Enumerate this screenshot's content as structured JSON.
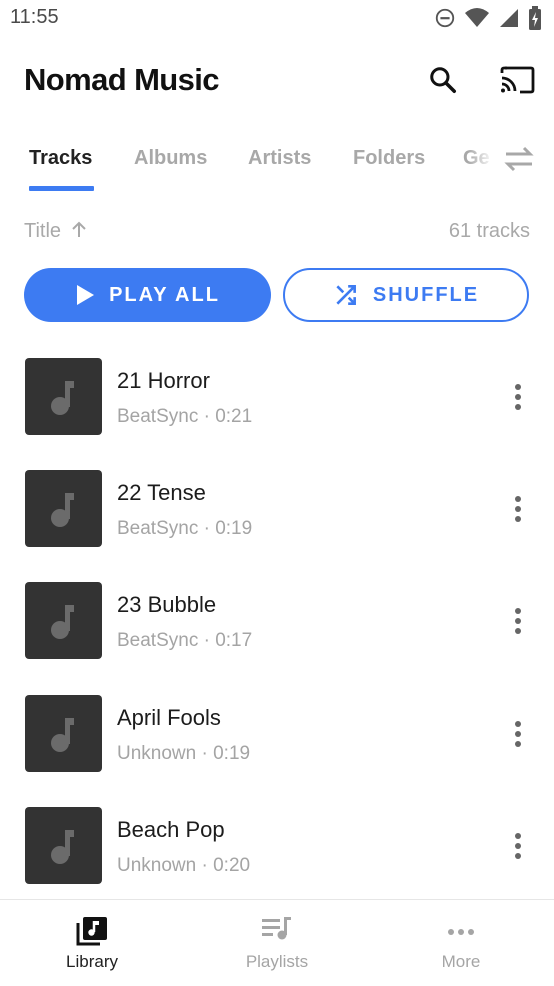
{
  "status_bar": {
    "time": "11:55",
    "icons": [
      "do-not-disturb-icon",
      "wifi-icon",
      "cell-signal-icon",
      "battery-charging-icon"
    ]
  },
  "app_bar": {
    "title": "Nomad Music",
    "actions": [
      "search-icon",
      "cast-icon"
    ]
  },
  "tabs": [
    {
      "label": "Tracks",
      "active": true
    },
    {
      "label": "Albums"
    },
    {
      "label": "Artists"
    },
    {
      "label": "Folders"
    },
    {
      "label": "Ge"
    }
  ],
  "tabs_menu_icon": "swap-icon",
  "sort": {
    "label": "Title",
    "direction_icon": "arrow-up-icon",
    "count": "61 tracks"
  },
  "actions": {
    "play_all": "PLAY ALL",
    "shuffle": "SHUFFLE"
  },
  "tracks": [
    {
      "title": "21 Horror",
      "subtitle": "BeatSync · 0:21"
    },
    {
      "title": "22 Tense",
      "subtitle": "BeatSync · 0:19"
    },
    {
      "title": "23 Bubble",
      "subtitle": "BeatSync · 0:17"
    },
    {
      "title": "April Fools",
      "subtitle": "Unknown · 0:19"
    },
    {
      "title": "Beach Pop",
      "subtitle": "Unknown · 0:20"
    }
  ],
  "bottom_nav": [
    {
      "label": "Library",
      "icon": "library-icon",
      "active": true
    },
    {
      "label": "Playlists",
      "icon": "playlist-icon"
    },
    {
      "label": "More",
      "icon": "more-horizontal-icon"
    }
  ],
  "colors": {
    "accent": "#3d7bf2",
    "art_bg": "#333333",
    "muted": "#a8a8a8"
  }
}
